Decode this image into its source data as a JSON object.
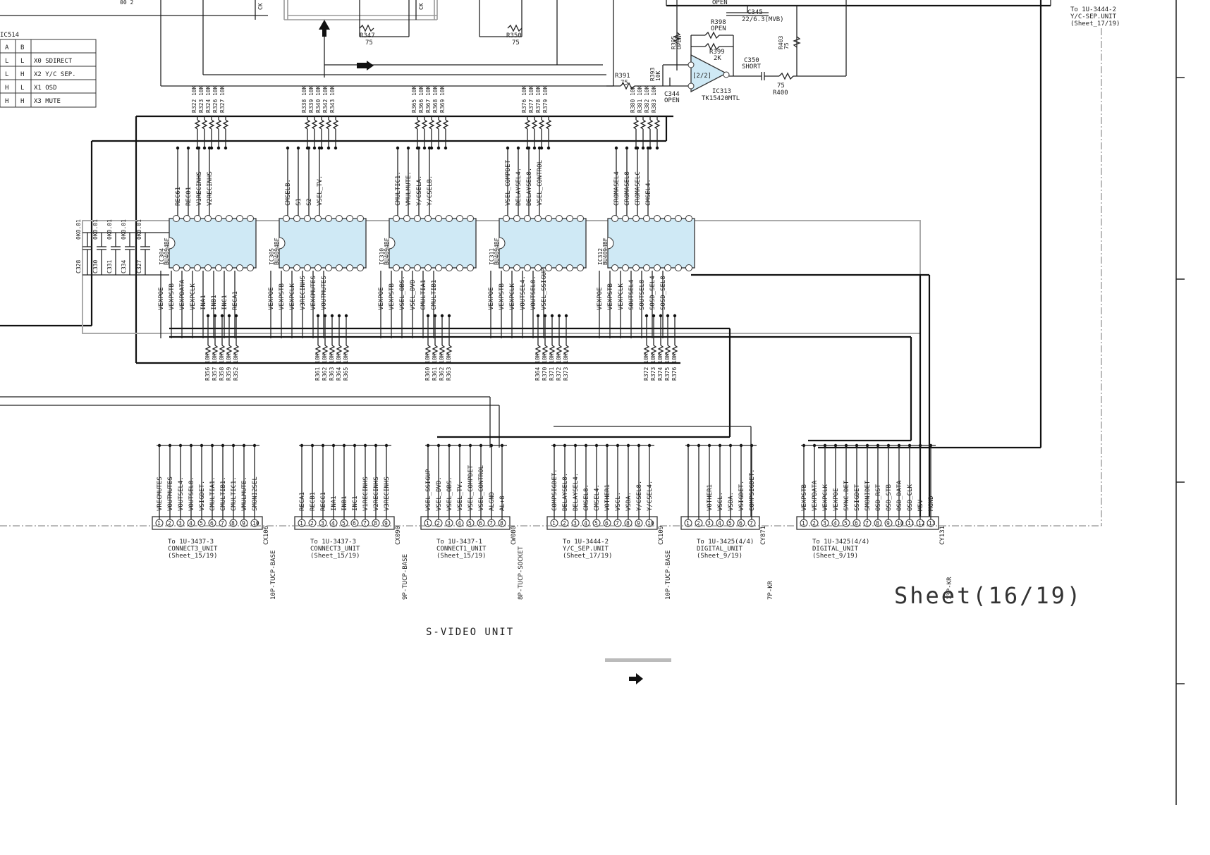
{
  "truth_table": {
    "title": "IC514",
    "header": [
      "A",
      "B",
      ""
    ],
    "rows": [
      [
        "L",
        "L",
        "X0  SDIRECT"
      ],
      [
        "L",
        "H",
        "X2  Y/C SEP."
      ],
      [
        "H",
        "L",
        "X1  OSD"
      ],
      [
        "H",
        "H",
        "X3  MUTE"
      ]
    ]
  },
  "top_parts": {
    "r347": "R347",
    "r347_val": "75",
    "r350": "R350",
    "r350_val": "75",
    "c345": "C345",
    "c345_val": "22/6.3(MVB)",
    "open_top": "OPEN",
    "r398": "R398",
    "r398_val": "OPEN",
    "r399": "R399",
    "r399_val": "2K",
    "c350": "C350",
    "c350_val": "SHORT",
    "r403": "R403",
    "r403_val": "75",
    "r391": "R391",
    "r391_val": "75",
    "r393": "R393",
    "r393_val": "10K",
    "r395": "R395",
    "r395_val": "OPEN",
    "c344": "C344",
    "c344_val": "OPEN",
    "ic313": "IC313",
    "ic313_part": "TK15420MTL",
    "opamp_unit": "[2/2]",
    "r400_val": "75",
    "r400": "R400"
  },
  "ycsep_ref": {
    "line1": "To 1U-3444-2",
    "line2": "Y/C-SEP.UNIT",
    "line3": "(Sheet_17/19)"
  },
  "bypass_caps": [
    {
      "ref": "C328",
      "val": "0K0.01"
    },
    {
      "ref": "C330",
      "val": "0K0.01"
    },
    {
      "ref": "C331",
      "val": "0K0.01"
    },
    {
      "ref": "C334",
      "val": "0K0.01"
    },
    {
      "ref": "C327",
      "val": "0K0.01"
    }
  ],
  "chips": [
    {
      "ref": "IC304",
      "part": "BU4094BF",
      "top_signals": [
        "REC61",
        "REC01",
        "V1RECINHS",
        "V2RECINHS"
      ],
      "bottom_signals": [
        "VEXPOE",
        "VEXPSTB",
        "VEXPDATA",
        "VEXPCLK",
        "INA1",
        "INB1",
        "INC1",
        "RECA1"
      ],
      "top_resistors": [
        "R322 10K",
        "R323 10K",
        "R324 10K",
        "R326 10K",
        "R327 10K"
      ],
      "bottom_resistors": [
        "R356 10K",
        "R357 10K",
        "R358 10K",
        "R359 10K",
        "R352 10K"
      ]
    },
    {
      "ref": "IC305",
      "part": "BU4094BF",
      "top_signals": [
        "CMSELB.",
        "S1",
        "S2",
        "VSEL_TV."
      ],
      "bottom_signals": [
        "VEXPOE",
        "VEXPSTB",
        "VEXPCLK",
        "V3RECINHS",
        "VEXCMUTES",
        "VOUTMUTES"
      ],
      "top_resistors": [
        "R338 10K",
        "R339 10K",
        "R340 10K",
        "R342 10K",
        "R343 10K"
      ],
      "bottom_resistors": [
        "R361 10K",
        "R362 10K",
        "R363 10K",
        "R364 10K",
        "R365 10K"
      ]
    },
    {
      "ref": "IC310",
      "part": "BU4094BF",
      "top_signals": [
        "CMULTIC1.",
        "VMULMUTE.",
        "Y/CSELA.",
        "Y/CSELB."
      ],
      "bottom_signals": [
        "VEXPOE",
        "VEXPSTB",
        "VSEL_OBS.",
        "VSEL_DVD",
        "CMULTIA1",
        "CMULTIB1"
      ],
      "top_resistors": [
        "R365 10K",
        "R366 10K",
        "R367 10K",
        "R368 10K",
        "R369 10K"
      ],
      "bottom_resistors": [
        "R360 10K",
        "R361 10K",
        "R362 10K",
        "R363 10K"
      ]
    },
    {
      "ref": "IC311",
      "part": "BU4094BF",
      "top_signals": [
        "VSEL_COMPDET",
        "DELAYSEL4.",
        "DELAYSEL8.",
        "VSEL_CONTROL"
      ],
      "bottom_signals": [
        "VEXPOE",
        "VEXPSTB",
        "VEXPCLK",
        "VOUTSEL4.",
        "VOUTSEL8.",
        "VSEL_SSIGUP"
      ],
      "top_resistors": [
        "R376 10K",
        "R377 10K",
        "R378 10K",
        "R379 10K"
      ],
      "bottom_resistors": [
        "R364 10K",
        "R370 10K",
        "R371 10K",
        "R372 10K",
        "R373 10K"
      ]
    },
    {
      "ref": "IC312",
      "part": "BU4094BF",
      "top_signals": [
        "CROMASEL4",
        "CROMASEL8",
        "CROMASELC",
        "CMSEL4."
      ],
      "bottom_signals": [
        "VEXPOE",
        "VEXPSTB",
        "VEXPCLK",
        "SOUTSEL4",
        "SOUTSEL8",
        "SOSD_SEL4",
        "SOSD_SEL8"
      ],
      "top_resistors": [
        "R380 10K",
        "R381 10K",
        "R382 10K",
        "R383 10K"
      ],
      "bottom_resistors": [
        "R372 10K",
        "R373 10K",
        "R374 10K",
        "R375 10K",
        "R376 10K"
      ]
    }
  ],
  "connectors": [
    {
      "id": "CX106",
      "type": "10P-TUCP-BASE",
      "pins": 10,
      "signals": [
        "VRECMUTES",
        "VOUTMUTES",
        "VOUTSEL4.",
        "VOUTSEL8.",
        "VSIGDET.",
        "CMULTIA1.",
        "CMULTIB1.",
        "CMULTIC1.",
        "VMULMUTE.",
        "SMONI2SEL"
      ],
      "ref1": "To 1U-3437-3",
      "ref2": "CONNECT3_UNIT",
      "ref3": "(Sheet_15/19)"
    },
    {
      "id": "CX090",
      "type": "9P-TUCP-BASE",
      "pins": 9,
      "signals": [
        "RECA1",
        "RECB1",
        "RECC1",
        "INA1",
        "INB1",
        "INC1",
        "V1RECINHS",
        "V2RECINHS",
        "V3RECINHS"
      ],
      "ref1": "To 1U-3437-3",
      "ref2": "CONNECT3_UNIT",
      "ref3": "(Sheet_15/19)"
    },
    {
      "id": "CW080",
      "type": "8P-TUCP-SOCKET",
      "pins": 8,
      "signals": [
        "VSEL_SSIGUP",
        "VSEL_DVD.",
        "VSEL_OBS.",
        "VSEL_TV.",
        "VSEL_COMPDET",
        "VSEL_CONTROL",
        "ALGND",
        "AL+8"
      ],
      "ref1": "To 1U-3437-1",
      "ref2": "CONNECT1_UNIT",
      "ref3": "(Sheet_15/19)"
    },
    {
      "id": "CX109",
      "type": "10P-TUCP-BASE",
      "pins": 10,
      "signals": [
        "COMPSIGDET.",
        "DELAYSEL8.",
        "DELAYSEL4.",
        "CMSEL8.",
        "CMSEL4.",
        "VOTHER1",
        "VSCL.",
        "VSDA.",
        "Y/CSEL8.",
        "Y/CSEL4."
      ],
      "ref1": "To 1U-3444-2",
      "ref2": "Y/C_SEP.UNIT",
      "ref3": "(Sheet_17/19)"
    },
    {
      "id": "CY871",
      "type": "7P-KR",
      "pins": 7,
      "signals": [
        "",
        "",
        "VOTHER1",
        "VSCL.",
        "VSDA.",
        "VSIGDET.",
        "COMPSIGDET."
      ],
      "ref1": "To 1U-3425(4/4)",
      "ref2": "DIGITAL_UNIT",
      "ref3": "(Sheet_9/19)"
    },
    {
      "id": "CY131",
      "type": "13P-KR",
      "pins": 13,
      "signals": [
        "VEXPSTB",
        "VEXPDATA",
        "VEXPCLK",
        "VEXPOE",
        "SYNC.DET",
        "SSIGDET",
        "SMONIDET",
        "OSD_RST",
        "OSD_STB",
        "OSD_DATA",
        "OSD_CLK",
        "M5V",
        "MGND"
      ],
      "ref1": "To 1U-3425(4/4)",
      "ref2": "DIGITAL_UNIT",
      "ref3": "(Sheet_9/19)"
    }
  ],
  "sheet_label": "Sheet(16/19)",
  "unit_label": "S-VIDEO UNIT"
}
